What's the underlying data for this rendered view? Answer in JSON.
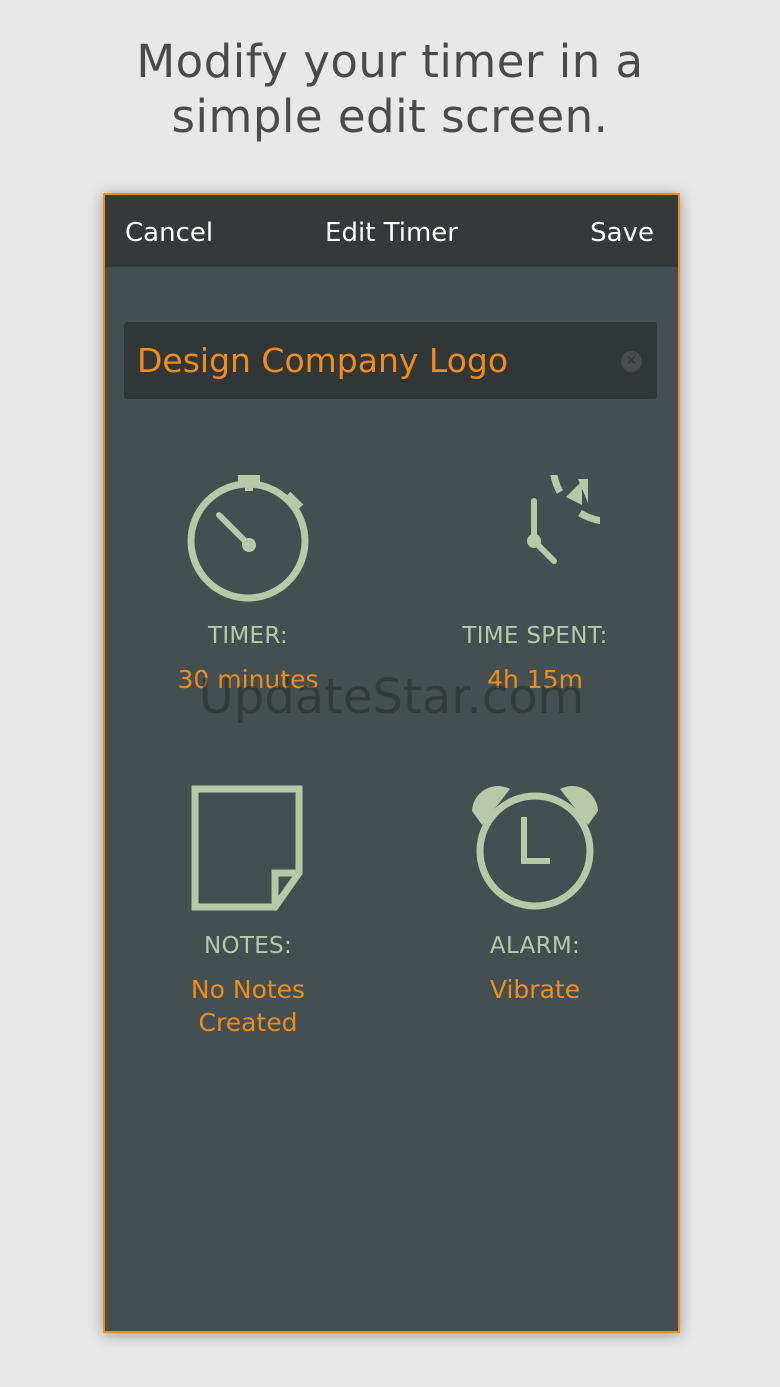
{
  "headline": {
    "line1": "Modify your timer in a",
    "line2": "simple edit screen."
  },
  "navbar": {
    "cancel_label": "Cancel",
    "title": "Edit Timer",
    "save_label": "Save"
  },
  "name_field": {
    "value": "Design Company Logo"
  },
  "tiles": {
    "timer": {
      "label": "TIMER:",
      "value": "30 minutes",
      "icon": "stopwatch-icon"
    },
    "time_spent": {
      "label": "TIME SPENT:",
      "value": "4h 15m",
      "icon": "clock-refresh-icon"
    },
    "notes": {
      "label": "NOTES:",
      "value_line1": "No Notes",
      "value_line2": "Created",
      "icon": "note-icon"
    },
    "alarm": {
      "label": "ALARM:",
      "value": "Vibrate",
      "icon": "alarm-clock-icon"
    }
  },
  "watermark": "UpdateStar.com",
  "colors": {
    "accent": "#f08c1e",
    "icon": "#b9c9a8",
    "background": "#444f51",
    "navbar": "#363839"
  }
}
